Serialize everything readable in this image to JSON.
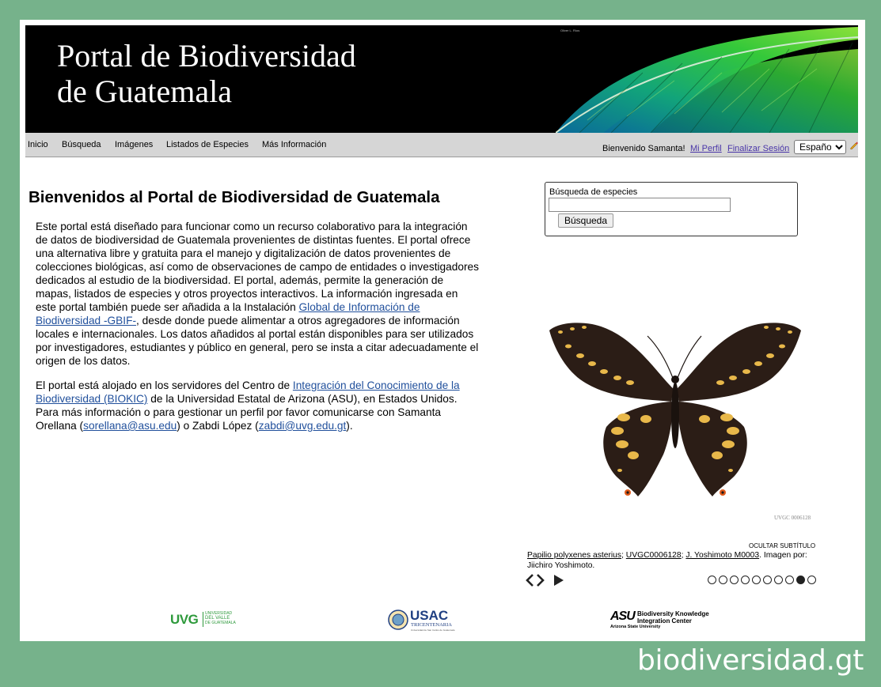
{
  "banner": {
    "title_line1": "Portal de Biodiversidad",
    "title_line2": "de Guatemala",
    "photo_credit": "Oliver L. Ríos"
  },
  "nav": {
    "items": [
      "Inicio",
      "Búsqueda",
      "Imágenes",
      "Listados de Especies",
      "Más Información"
    ],
    "welcome": "Bienvenido Samanta!",
    "my_profile": "Mi Perfil",
    "logout": "Finalizar Sesión",
    "language": "Español"
  },
  "main": {
    "title": "Bienvenidos al Portal de Biodiversidad de Guatemala",
    "p1_a": "Este portal está diseñado para funcionar como un recurso colaborativo para la integración de datos de biodiversidad de Guatemala provenientes de distintas fuentes. El portal ofrece una alternativa libre y gratuita para el manejo y digitalización de datos provenientes de colecciones biológicas, así como de observaciones de campo de entidades o investigadores dedicados al estudio de la biodiversidad. El portal, además, permite la generación de mapas, listados de especies y otros proyectos interactivos. La información ingresada en este portal también puede ser añadida a la Instalación ",
    "p1_link": "Global de Información de Biodiversidad -GBIF-",
    "p1_b": ", desde donde puede alimentar a otros agregadores de información locales e internacionales. Los datos añadidos al portal están disponibles para ser utilizados por investigadores, estudiantes y público en general, pero se insta a citar adecuadamente el origen de los datos.",
    "p2_a": "El portal está alojado en los servidores del Centro de ",
    "p2_link": "Integración del Conocimiento de la Biodiversidad (BIOKIC)",
    "p2_b": " de la Universidad Estatal de Arizona (ASU), en Estados Unidos. Para más información o para gestionar un perfil por favor comunicarse con Samanta Orellana (",
    "p2_email1": "sorellana@asu.edu",
    "p2_c": ") o Zabdi López (",
    "p2_email2": "zabdi@uvg.edu.gt",
    "p2_d": ")."
  },
  "search": {
    "label": "Búsqueda de especies",
    "value": "",
    "button": "Búsqueda"
  },
  "slideshow": {
    "specimen_label": "UVGC 0006128",
    "hide_caption": "OCULTAR SUBTÍTULO",
    "caption_link1": "Papilio polyxenes asterius",
    "caption_link2": "UVGC0006128",
    "caption_link3": "J. Yoshimoto M0003",
    "caption_sep": "; ",
    "caption_rest": ". Imagen por: Jiichiro Yoshimoto.",
    "slide_count": 10,
    "active_slide": 9
  },
  "logos": {
    "uvg_mark": "UVG",
    "uvg_line1": "UNIVERSIDAD",
    "uvg_line2": "DEL VALLE",
    "uvg_line3": "DE GUATEMALA",
    "usac_mark": "USAC",
    "usac_line1": "TRICENTENARIA",
    "usac_line2": "Universidad de San Carlos de Guatemala",
    "asu_mark": "ASU",
    "asu_line1": "Biodiversity Knowledge",
    "asu_line2": "Integration Center",
    "asu_line3": "Arizona State University"
  },
  "watermark": "biodiversidad.gt",
  "colors": {
    "outer_background": "#76b28b",
    "banner": "#000000",
    "navbar": "#d6d6d6",
    "link": "#21509c",
    "uvg_green": "#2e9a3c",
    "usac_blue": "#1f3f82"
  }
}
